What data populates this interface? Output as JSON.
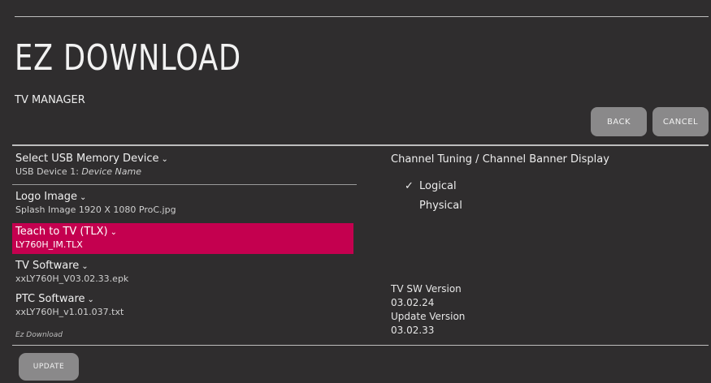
{
  "header": {
    "title": "EZ DOWNLOAD",
    "subtitle": "TV MANAGER",
    "back_label": "BACK",
    "cancel_label": "CANCEL"
  },
  "settings": {
    "usb": {
      "label": "Select USB Memory Device",
      "value_prefix": "USB Device 1: ",
      "value_name": "Device Name"
    },
    "logo": {
      "label": "Logo Image",
      "value": "Splash Image 1920 X 1080 ProC.jpg"
    },
    "teach": {
      "label": "Teach to TV (TLX)",
      "value": "LY760H_IM.TLX"
    },
    "tv_software": {
      "label": "TV Software",
      "value": "xxLY760H_V03.02.33.epk"
    },
    "ptc_software": {
      "label": "PTC Software",
      "value": "xxLY760H_v1.01.037.txt"
    },
    "chevron": "⌄"
  },
  "footer_note": "Ez Download",
  "update_label": "UPDATE",
  "channel": {
    "title": "Channel Tuning / Channel Banner Display",
    "options": [
      {
        "label": "Logical",
        "selected": true
      },
      {
        "label": "Physical",
        "selected": false
      }
    ],
    "check_glyph": "✓"
  },
  "versions": {
    "tv_sw_label": "TV SW Version",
    "tv_sw_value": "03.02.24",
    "update_label": "Update Version",
    "update_value": "03.02.33"
  },
  "colors": {
    "background": "#2f2d2e",
    "highlight": "#c4004f",
    "button": "#8a898a"
  }
}
